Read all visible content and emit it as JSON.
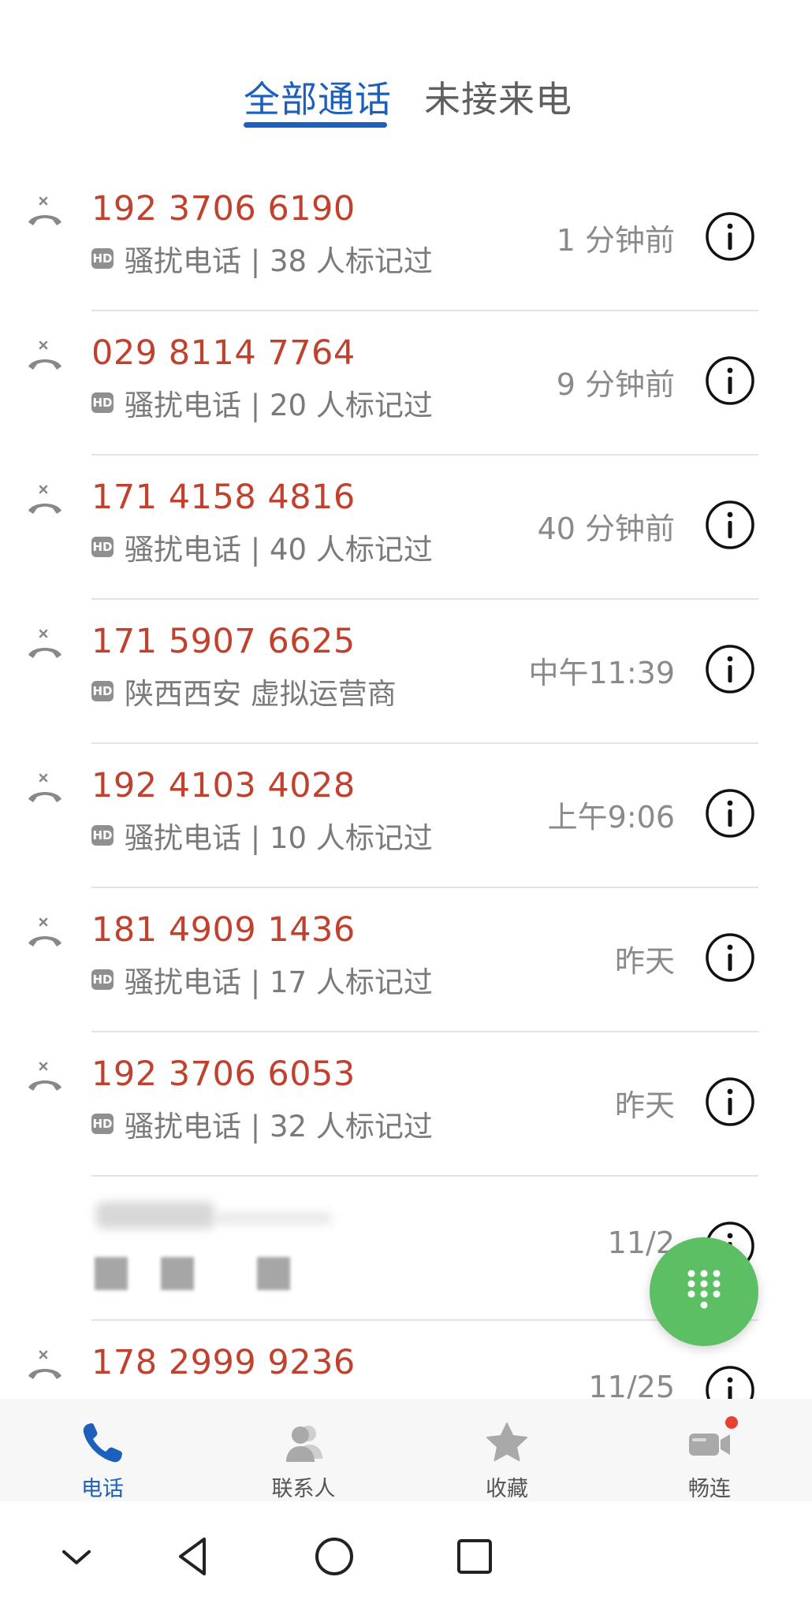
{
  "tabs": {
    "all_calls": "全部通话",
    "missed_calls": "未接来电"
  },
  "calls": [
    {
      "number": "192 3706 6190",
      "sub": "骚扰电话 | 38 人标记过",
      "time": "1 分钟前"
    },
    {
      "number": "029 8114 7764",
      "sub": "骚扰电话 | 20 人标记过",
      "time": "9 分钟前"
    },
    {
      "number": "171 4158 4816",
      "sub": "骚扰电话 | 40 人标记过",
      "time": "40 分钟前"
    },
    {
      "number": "171 5907 6625",
      "sub": "陕西西安 虚拟运营商",
      "time": "中午11:39"
    },
    {
      "number": "192 4103 4028",
      "sub": "骚扰电话 | 10 人标记过",
      "time": "上午9:06"
    },
    {
      "number": "181 4909 1436",
      "sub": "骚扰电话 | 17 人标记过",
      "time": "昨天"
    },
    {
      "number": "192 3706 6053",
      "sub": "骚扰电话 | 32 人标记过",
      "time": "昨天"
    },
    {
      "number": "",
      "sub": "",
      "time": "11/2"
    },
    {
      "number": "178 2999 9236",
      "sub": "",
      "time": "11/25"
    }
  ],
  "hd_badge": "HD",
  "bottom_nav": {
    "phone": "电话",
    "contacts": "联系人",
    "favorites": "收藏",
    "meetime": "畅连"
  },
  "colors": {
    "accent": "#1d5fbd",
    "missed_number": "#c0422e",
    "fab": "#5cbf64",
    "badge_dot": "#e84033"
  }
}
